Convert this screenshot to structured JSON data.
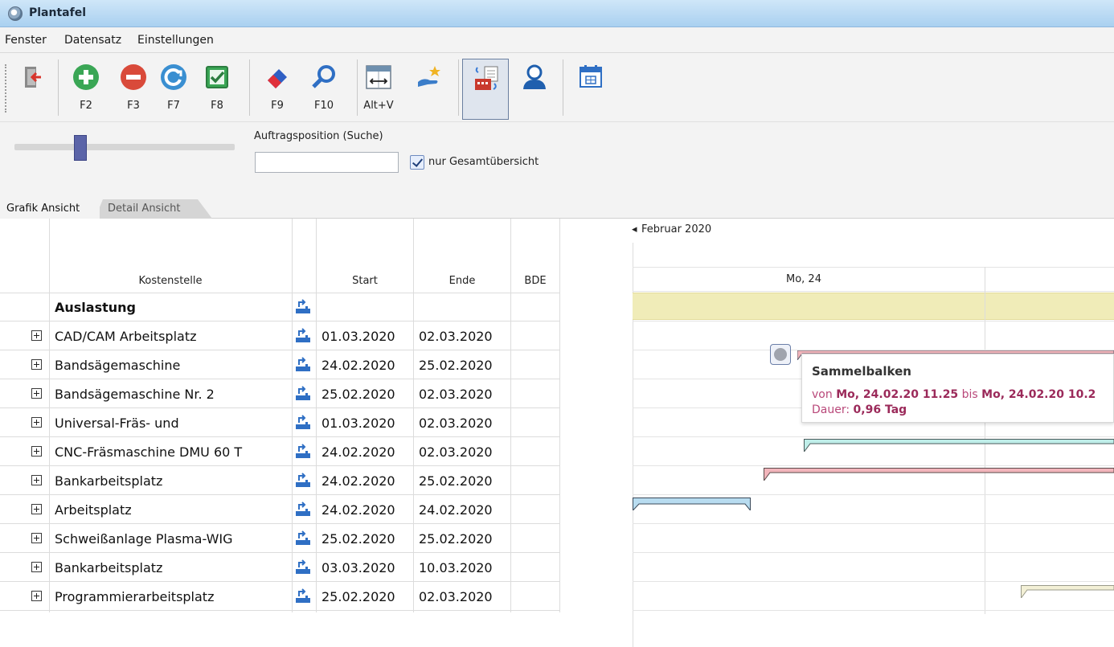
{
  "window": {
    "title": "Plantafel"
  },
  "menu": [
    "Fenster",
    "Datensatz",
    "Einstellungen"
  ],
  "toolbar": {
    "buttons": [
      {
        "icon": "exit-icon",
        "key": ""
      },
      {
        "icon": "add-icon",
        "key": "F2"
      },
      {
        "icon": "remove-icon",
        "key": "F3"
      },
      {
        "icon": "refresh-icon",
        "key": "F7"
      },
      {
        "icon": "check-icon",
        "key": "F8"
      },
      {
        "icon": "eraser-icon",
        "key": "F9"
      },
      {
        "icon": "search-icon",
        "key": "F10"
      },
      {
        "icon": "column-width-icon",
        "key": "Alt+V"
      },
      {
        "icon": "hand-star-icon",
        "key": ""
      },
      {
        "icon": "planning-board-icon",
        "key": ""
      },
      {
        "icon": "user-icon",
        "key": ""
      },
      {
        "icon": "calendar-icon",
        "key": ""
      }
    ]
  },
  "filter": {
    "search_label": "Auftragsposition (Suche)",
    "search_value": "",
    "checkbox_label": "nur Gesamtübersicht",
    "checkbox_checked": true
  },
  "tabs": [
    "Grafik Ansicht",
    "Detail Ansicht"
  ],
  "grid": {
    "headers": {
      "kostenstelle": "Kostenstelle",
      "start": "Start",
      "ende": "Ende",
      "bde": "BDE"
    },
    "summary": {
      "label": "Auslastung"
    },
    "rows": [
      {
        "name": "CAD/CAM Arbeitsplatz",
        "start": "01.03.2020",
        "end": "02.03.2020"
      },
      {
        "name": "Bandsägemaschine",
        "start": "24.02.2020",
        "end": "25.02.2020"
      },
      {
        "name": "Bandsägemaschine Nr. 2",
        "start": "25.02.2020",
        "end": "02.03.2020"
      },
      {
        "name": "Universal-Fräs- und",
        "start": "01.03.2020",
        "end": "02.03.2020"
      },
      {
        "name": "CNC-Fräsmaschine DMU 60 T",
        "start": "24.02.2020",
        "end": "02.03.2020"
      },
      {
        "name": "Bankarbeitsplatz",
        "start": "24.02.2020",
        "end": "25.02.2020"
      },
      {
        "name": "Arbeitsplatz",
        "start": "24.02.2020",
        "end": "24.02.2020"
      },
      {
        "name": "Schweißanlage Plasma-WIG",
        "start": "25.02.2020",
        "end": "25.02.2020"
      },
      {
        "name": "Bankarbeitsplatz",
        "start": "03.03.2020",
        "end": "10.03.2020"
      },
      {
        "name": "Programmierarbeitsplatz",
        "start": "25.02.2020",
        "end": "02.03.2020"
      }
    ]
  },
  "timeline": {
    "month": "Februar 2020",
    "day": "Mo, 24",
    "colors": {
      "load": "#f0ecb8",
      "bar_pink": "#f2b5bb",
      "bar_teal": "#bfeee9",
      "bar_blue": "#b8dcf0",
      "bar_beige": "#f3f0d6"
    }
  },
  "tooltip": {
    "title": "Sammelbalken",
    "von": "von",
    "from": "Mo, 24.02.20 11.25",
    "bis": "bis",
    "to": "Mo, 24.02.20 10.2",
    "dauer_label": "Dauer:",
    "dauer_value": "0,96 Tag"
  }
}
